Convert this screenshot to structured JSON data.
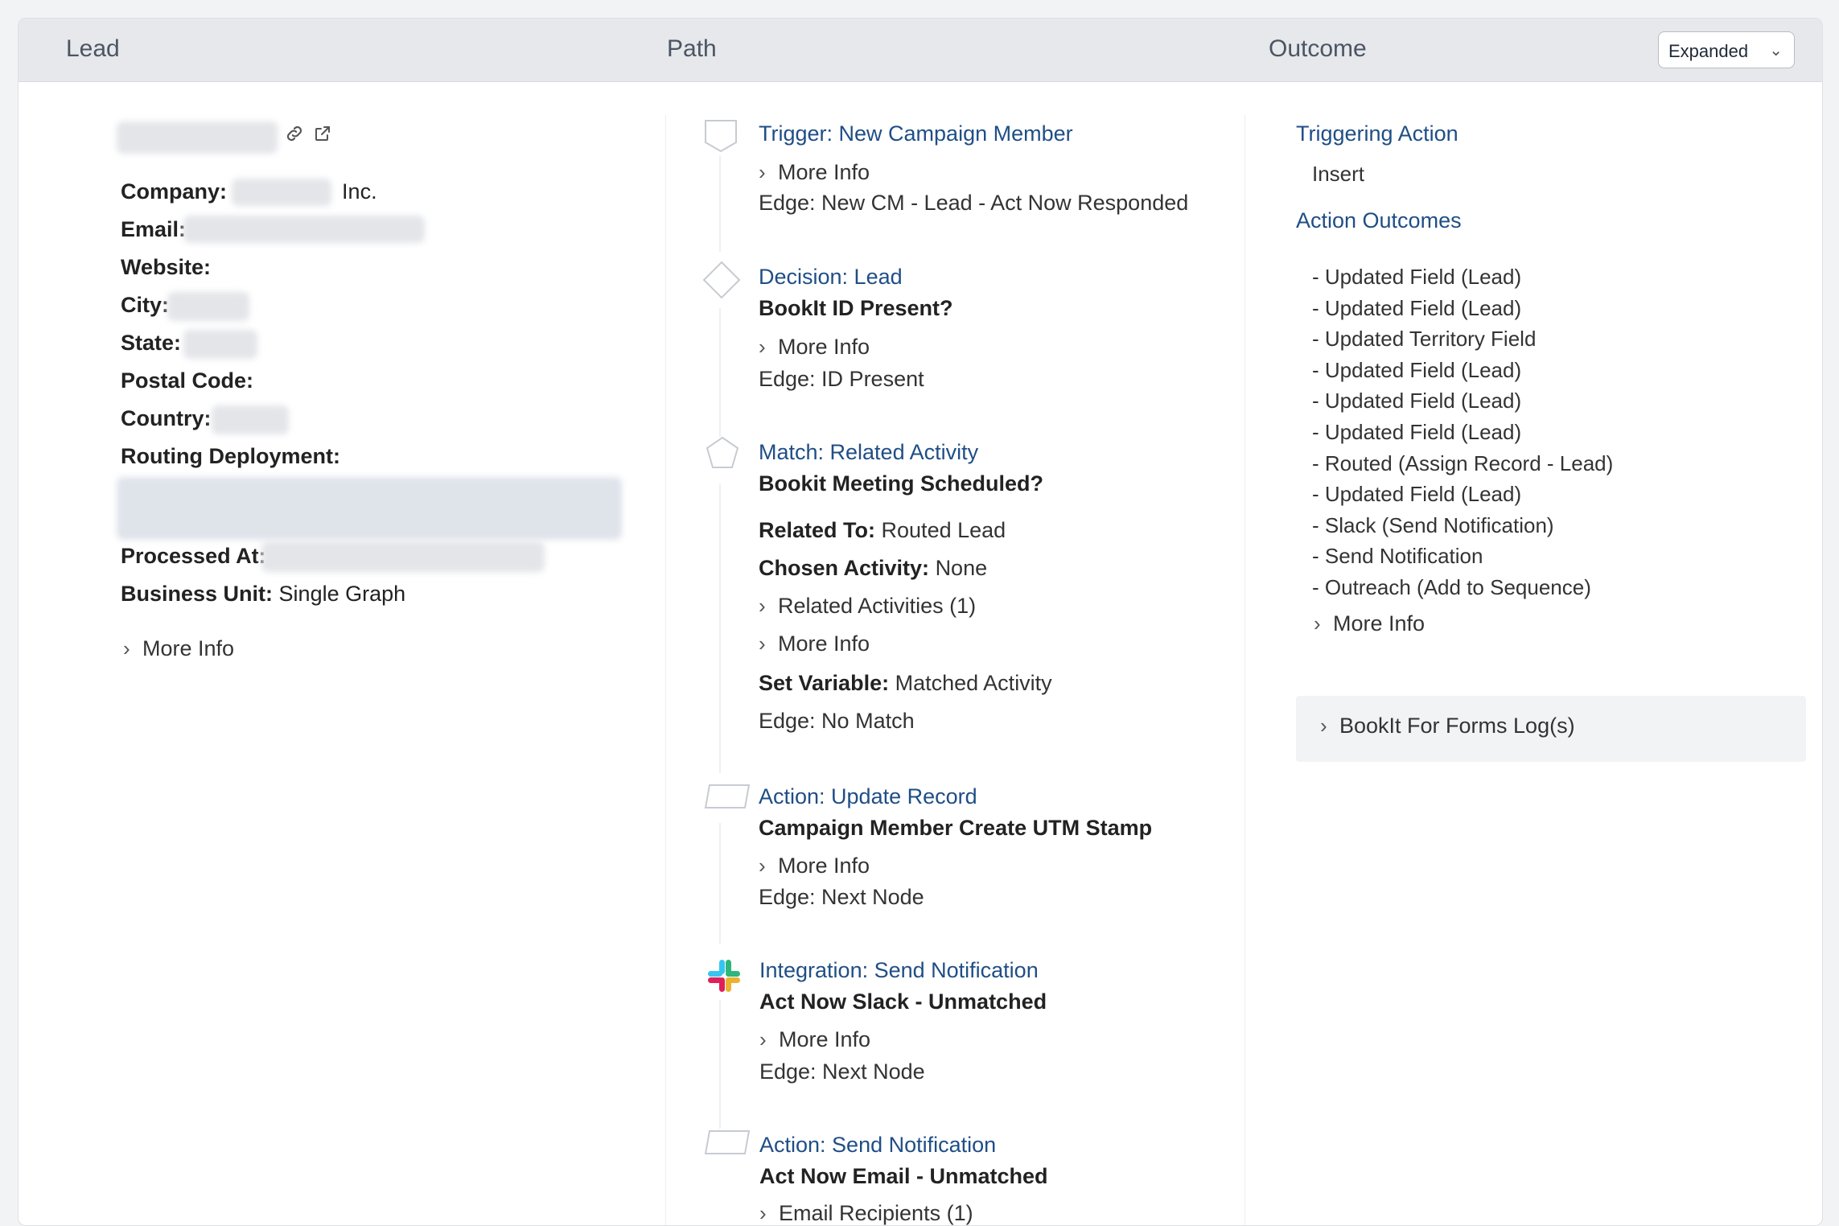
{
  "header": {
    "col_lead": "Lead",
    "col_path": "Path",
    "col_outcome": "Outcome",
    "view_select": "Expanded"
  },
  "lead": {
    "company_label": "Company:",
    "company_suffix": "Inc.",
    "email_label": "Email:",
    "website_label": "Website:",
    "city_label": "City:",
    "state_label": "State:",
    "postal_label": "Postal Code:",
    "country_label": "Country:",
    "routing_label": "Routing Deployment:",
    "processed_label": "Processed At:",
    "business_unit_label": "Business Unit:",
    "business_unit_value": "Single Graph",
    "more_info": "More Info"
  },
  "path": {
    "nodes": [
      {
        "title": "Trigger: New Campaign Member",
        "more_info": "More Info",
        "edge": "Edge: New CM - Lead - Act Now Responded"
      },
      {
        "title": "Decision: Lead",
        "subtitle": "BookIt ID Present?",
        "more_info": "More Info",
        "edge": "Edge: ID Present"
      },
      {
        "title": "Match: Related Activity",
        "subtitle": "Bookit Meeting Scheduled?",
        "related_to_label": "Related To:",
        "related_to_value": "Routed Lead",
        "chosen_label": "Chosen Activity:",
        "chosen_value": "None",
        "related_activities": "Related Activities (1)",
        "more_info": "More Info",
        "set_var_label": "Set Variable:",
        "set_var_value": "Matched Activity",
        "edge": "Edge: No Match"
      },
      {
        "title": "Action: Update Record",
        "subtitle": "Campaign Member Create UTM Stamp",
        "more_info": "More Info",
        "edge": "Edge: Next Node"
      },
      {
        "title": "Integration: Send Notification",
        "subtitle": "Act Now Slack - Unmatched",
        "more_info": "More Info",
        "edge": "Edge: Next Node"
      },
      {
        "title": "Action: Send Notification",
        "subtitle": "Act Now Email - Unmatched",
        "email_recipients": "Email Recipients (1)"
      }
    ]
  },
  "outcome": {
    "triggering_title": "Triggering Action",
    "triggering_value": "Insert",
    "outcomes_title": "Action Outcomes",
    "items": [
      "- Updated Field (Lead)",
      "- Updated Field (Lead)",
      "- Updated Territory Field",
      "- Updated Field (Lead)",
      "- Updated Field (Lead)",
      "- Updated Field (Lead)",
      "- Routed (Assign Record - Lead)",
      "- Updated Field (Lead)",
      "- Slack (Send Notification)",
      "- Send Notification",
      "- Outreach (Add to Sequence)"
    ],
    "more_info": "More Info",
    "log_label": "BookIt For Forms Log(s)"
  },
  "colors": {
    "title_blue": "#1f4e86",
    "header_bg": "#e6e8eb"
  }
}
